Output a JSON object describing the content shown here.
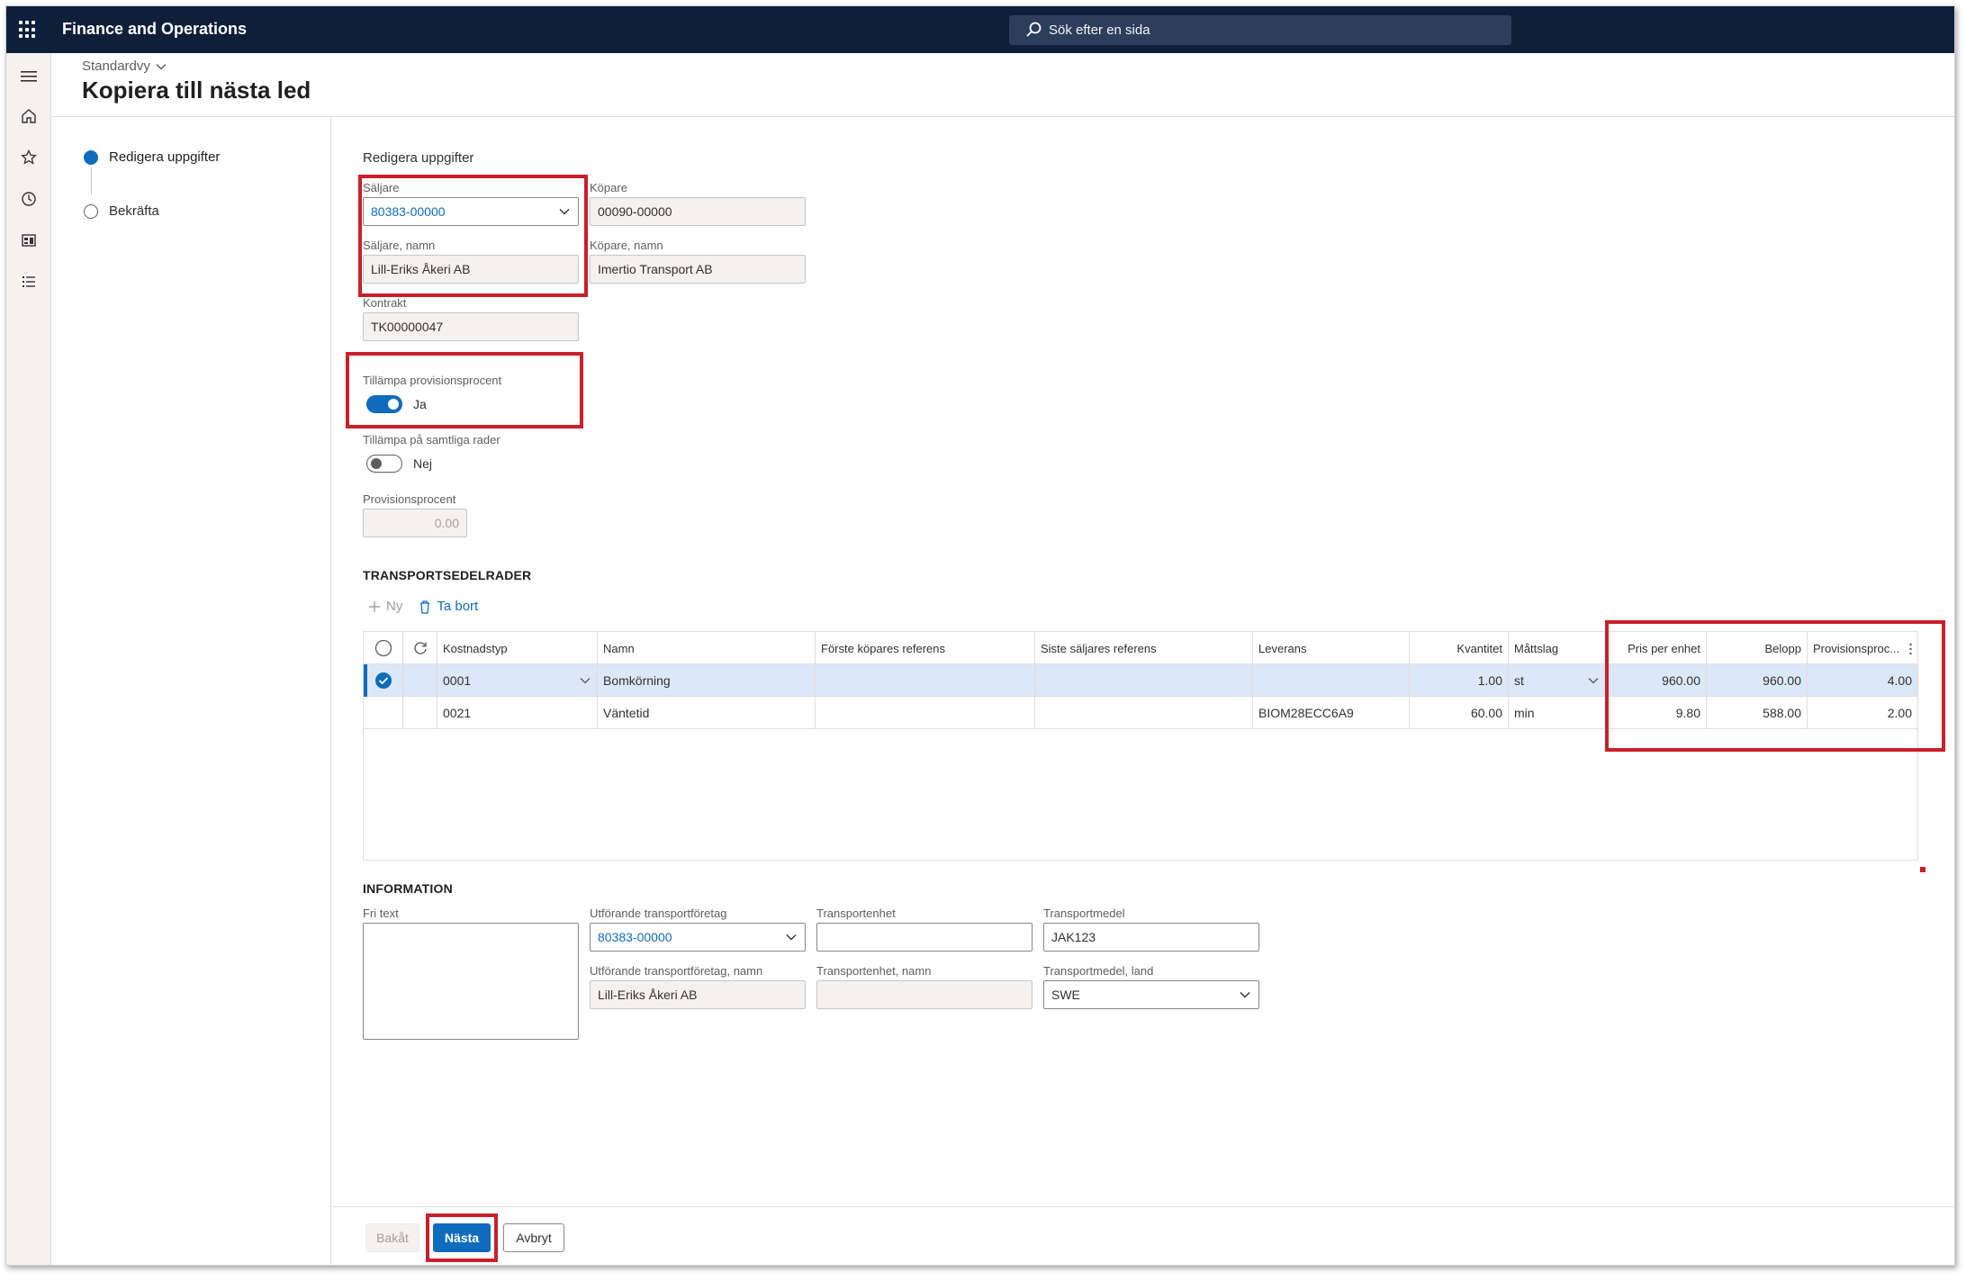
{
  "app": {
    "title": "Finance and Operations",
    "search_placeholder": "Sök efter en sida"
  },
  "header": {
    "view": "Standardvy",
    "page_title": "Kopiera till nästa led"
  },
  "steps": [
    {
      "label": "Redigera uppgifter",
      "state": "active"
    },
    {
      "label": "Bekräfta",
      "state": "pending"
    }
  ],
  "form": {
    "section_title": "Redigera uppgifter",
    "seller": {
      "label": "Säljare",
      "value": "80383-00000"
    },
    "seller_name": {
      "label": "Säljare, namn",
      "value": "Lill-Eriks Åkeri AB"
    },
    "buyer": {
      "label": "Köpare",
      "value": "00090-00000"
    },
    "buyer_name": {
      "label": "Köpare, namn",
      "value": "Imertio Transport AB"
    },
    "contract": {
      "label": "Kontrakt",
      "value": "TK00000047"
    },
    "apply_commission": {
      "label": "Tillämpa provisionsprocent",
      "value": "Ja",
      "on": true
    },
    "apply_all_rows": {
      "label": "Tillämpa på samtliga rader",
      "value": "Nej",
      "on": false
    },
    "commission_percent": {
      "label": "Provisionsprocent",
      "value": "0.00"
    }
  },
  "grid": {
    "section_title": "TRANSPORTSEDELRADER",
    "toolbar": {
      "new": "Ny",
      "delete": "Ta bort"
    },
    "columns": [
      "Kostnadstyp",
      "Namn",
      "Förste köpares referens",
      "Siste säljares referens",
      "Leverans",
      "Kvantitet",
      "Måttslag",
      "Pris per enhet",
      "Belopp",
      "Provisionsproc..."
    ],
    "rows": [
      {
        "cost_type": "0001",
        "name": "Bomkörning",
        "first_buyer_ref": "",
        "last_seller_ref": "",
        "delivery": "",
        "quantity": "1.00",
        "unit": "st",
        "unit_price": "960.00",
        "amount": "960.00",
        "commission": "4.00",
        "selected": true
      },
      {
        "cost_type": "0021",
        "name": "Väntetid",
        "first_buyer_ref": "",
        "last_seller_ref": "",
        "delivery": "BIOM28ECC6A9",
        "quantity": "60.00",
        "unit": "min",
        "unit_price": "9.80",
        "amount": "588.00",
        "commission": "2.00",
        "selected": false
      }
    ]
  },
  "information": {
    "section_title": "INFORMATION",
    "free_text": {
      "label": "Fri text",
      "value": ""
    },
    "carrier": {
      "label": "Utförande transportföretag",
      "value": "80383-00000"
    },
    "carrier_name": {
      "label": "Utförande transportföretag, namn",
      "value": "Lill-Eriks Åkeri AB"
    },
    "transport_unit": {
      "label": "Transportenhet",
      "value": ""
    },
    "transport_unit_name": {
      "label": "Transportenhet, namn",
      "value": ""
    },
    "vehicle": {
      "label": "Transportmedel",
      "value": "JAK123"
    },
    "vehicle_country": {
      "label": "Transportmedel, land",
      "value": "SWE"
    }
  },
  "footer": {
    "back": "Bakåt",
    "next": "Nästa",
    "cancel": "Avbryt"
  },
  "colors": {
    "topbar": "#0f1f3a",
    "accent": "#0f6cbd",
    "highlight_box": "#c8202b",
    "selected_row": "#dce7f8"
  },
  "icons": [
    "waffle-icon",
    "search-icon",
    "hamburger-icon",
    "home-icon",
    "star-icon",
    "clock-icon",
    "workspace-icon",
    "list-icon",
    "plus-icon",
    "trash-icon",
    "refresh-icon",
    "chevron-down-icon",
    "check-circle-icon"
  ]
}
